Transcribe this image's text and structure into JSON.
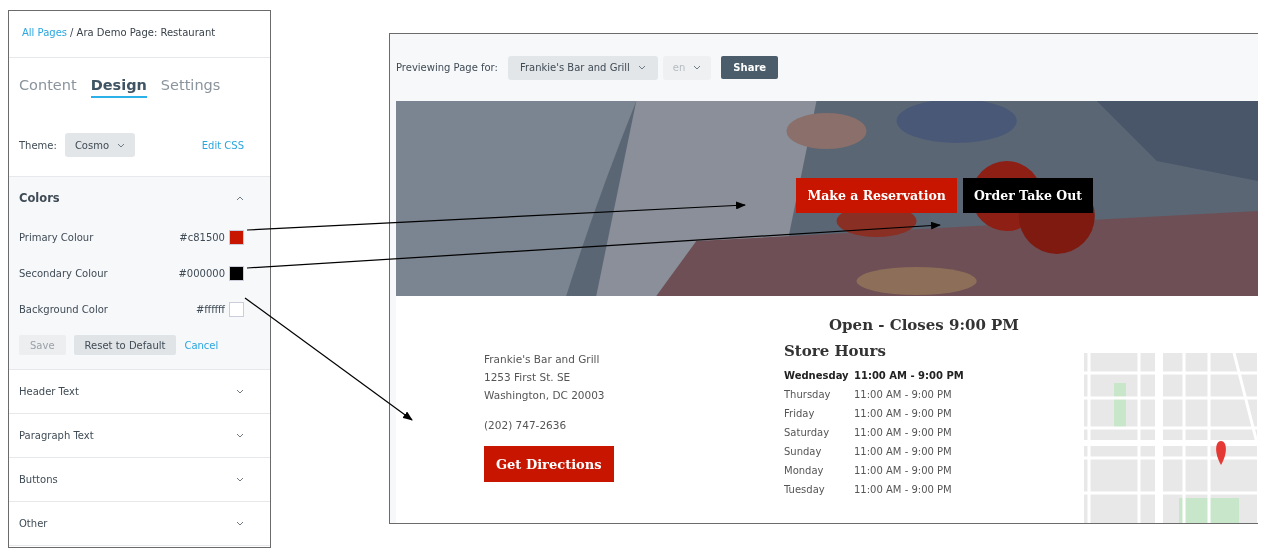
{
  "breadcrumb": {
    "link": "All Pages",
    "rest": "/ Ara Demo Page: Restaurant"
  },
  "tabs": [
    {
      "label": "Content",
      "selected": false
    },
    {
      "label": "Design",
      "selected": true
    },
    {
      "label": "Settings",
      "selected": false
    }
  ],
  "theme": {
    "label": "Theme:",
    "value": "Cosmo",
    "edit_css": "Edit CSS"
  },
  "sections": [
    {
      "title": "Colors",
      "expanded": true
    },
    {
      "title": "Header Text",
      "expanded": false
    },
    {
      "title": "Paragraph Text",
      "expanded": false
    },
    {
      "title": "Buttons",
      "expanded": false
    },
    {
      "title": "Other",
      "expanded": false
    }
  ],
  "colors": [
    {
      "label": "Primary Colour",
      "value": "#c81500",
      "color": "#c81500"
    },
    {
      "label": "Secondary Colour",
      "value": "#000000",
      "color": "#000000"
    },
    {
      "label": "Background Color",
      "value": "#ffffff",
      "color": "#ffffff"
    }
  ],
  "color_actions": {
    "save": {
      "label": "Save",
      "disabled": true
    },
    "reset": "Reset to Default",
    "cancel": "Cancel"
  },
  "preview": {
    "label": "Previewing Page for:",
    "location": "Frankie's Bar and Grill",
    "language": {
      "value": "en",
      "disabled": true
    },
    "share": "Share"
  },
  "hero": {
    "kind": "picture",
    "buttons": [
      "Make a Reservation",
      "Order Take Out"
    ]
  },
  "address": [
    "Frankie's Bar and Grill",
    "1253 First St. SE",
    "Washington, DC 20003"
  ],
  "phone": "(202) 747-2636",
  "directions": "Get Directions",
  "status": "Open - Closes 9:00 PM",
  "hours_title": "Store Hours",
  "hours": [
    {
      "day": "Wednesday",
      "time": "11:00 AM - 9:00 PM",
      "current": true
    },
    {
      "day": "Thursday",
      "time": "11:00 AM - 9:00 PM",
      "current": false
    },
    {
      "day": "Friday",
      "time": "11:00 AM - 9:00 PM",
      "current": false
    },
    {
      "day": "Saturday",
      "time": "11:00 AM - 9:00 PM",
      "current": false
    },
    {
      "day": "Sunday",
      "time": "11:00 AM - 9:00 PM",
      "current": false
    },
    {
      "day": "Monday",
      "time": "11:00 AM - 9:00 PM",
      "current": false
    },
    {
      "day": "Tuesday",
      "time": "11:00 AM - 9:00 PM",
      "current": false
    }
  ]
}
